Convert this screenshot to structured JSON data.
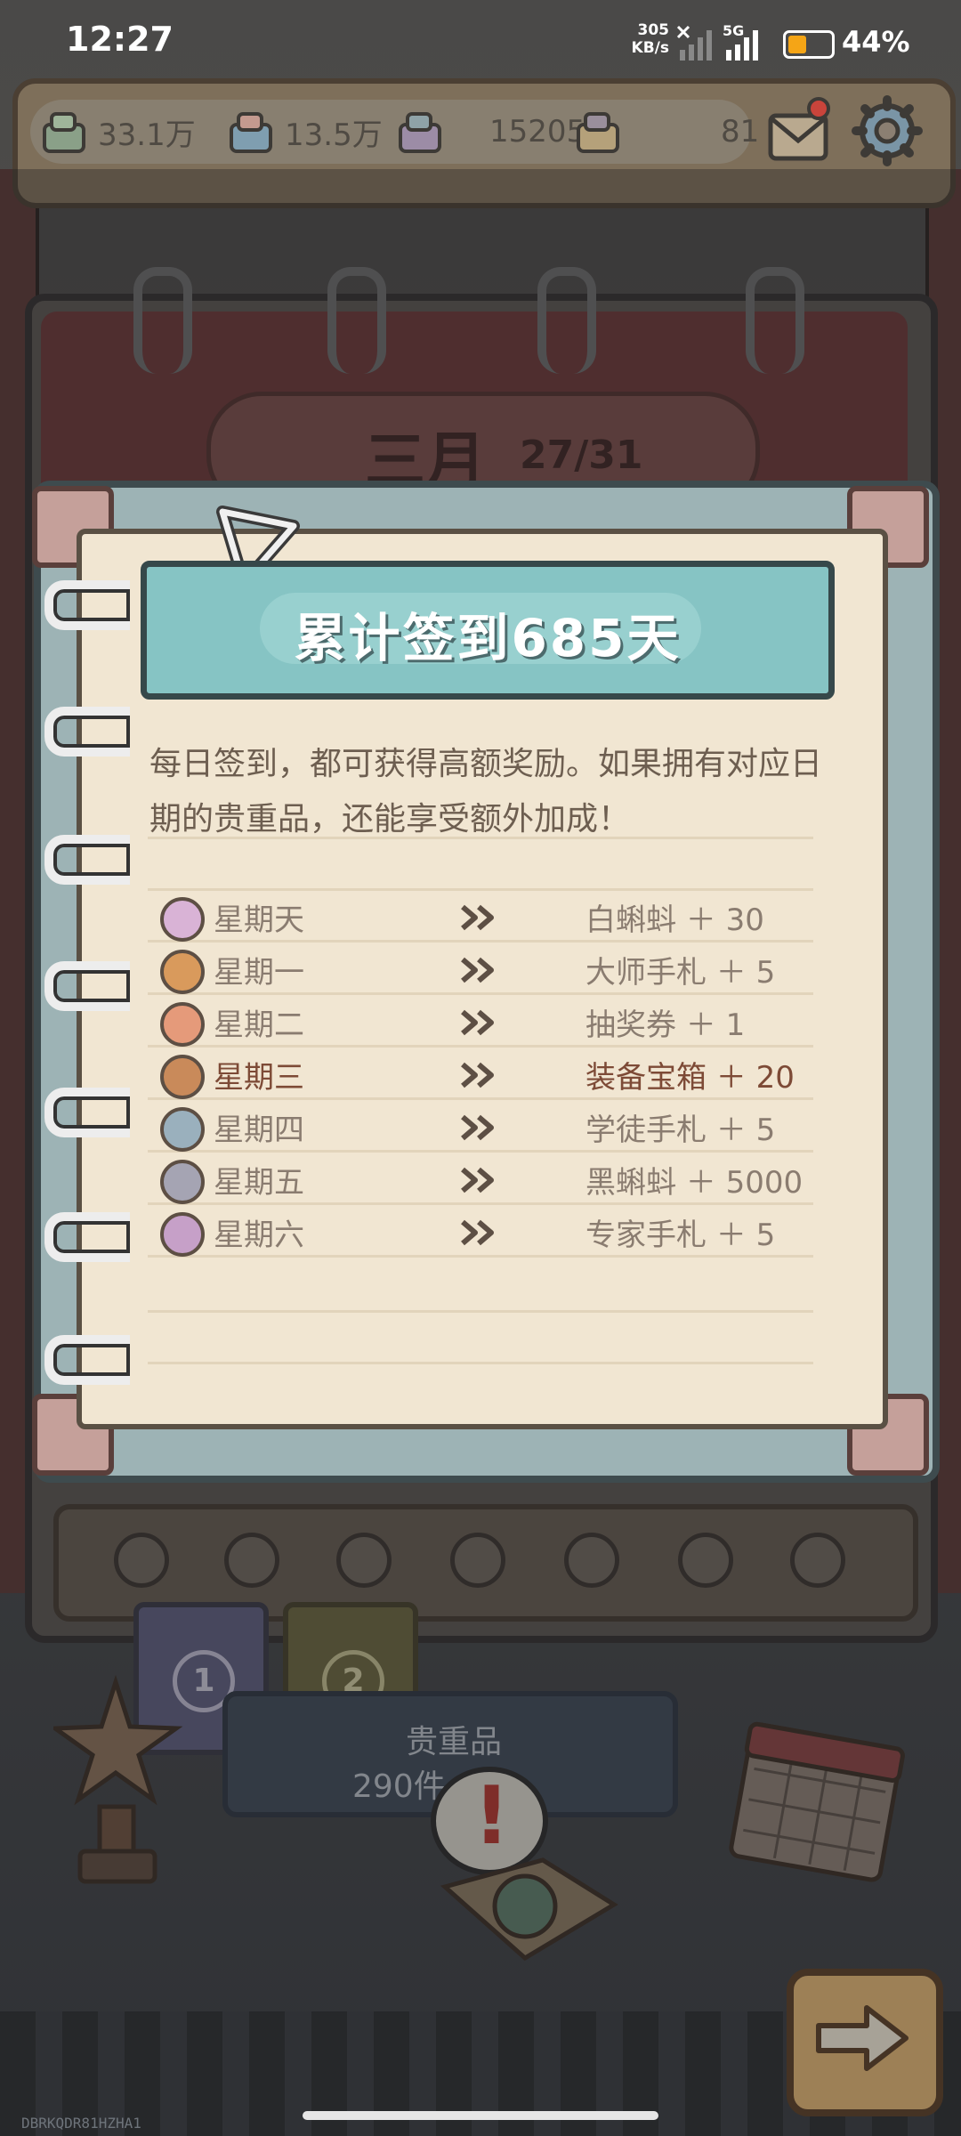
{
  "status_bar": {
    "time": "12:27",
    "net_speed": "305",
    "net_unit": "KB/s",
    "network": "5G",
    "battery": "44%",
    "battery_level": 0.44
  },
  "resources": [
    {
      "name": "gem-stack-green-icon",
      "value": "33.1万"
    },
    {
      "name": "gem-stack-blue-icon",
      "value": "13.5万"
    },
    {
      "name": "gem-stack-purple-icon",
      "value": "15205"
    },
    {
      "name": "gem-stack-gold-icon",
      "value": "81"
    }
  ],
  "calendar": {
    "month": "三月",
    "progress": "27/31"
  },
  "popup": {
    "title": "累计签到685天",
    "description": "每日签到，都可获得高额奖励。如果拥有对应日期的贵重品，还能享受额外加成！",
    "rows": [
      {
        "day": "星期天",
        "reward": "白蝌蚪 ＋ 30",
        "icon": "white-tadpole-icon",
        "color": "#d9b3d6",
        "active": false
      },
      {
        "day": "星期一",
        "reward": "大师手札 ＋ 5",
        "icon": "master-note-icon",
        "color": "#d99a5c",
        "active": false
      },
      {
        "day": "星期二",
        "reward": "抽奖券 ＋ 1",
        "icon": "lottery-ticket-icon",
        "color": "#e59a7a",
        "active": false
      },
      {
        "day": "星期三",
        "reward": "装备宝箱 ＋ 20",
        "icon": "equipment-chest-icon",
        "color": "#c98a5a",
        "active": true
      },
      {
        "day": "星期四",
        "reward": "学徒手札 ＋ 5",
        "icon": "apprentice-note-icon",
        "color": "#9ab0bd",
        "active": false
      },
      {
        "day": "星期五",
        "reward": "黑蝌蚪 ＋ 5000",
        "icon": "black-tadpole-icon",
        "color": "#a5a4b3",
        "active": false
      },
      {
        "day": "星期六",
        "reward": "专家手札 ＋ 5",
        "icon": "expert-note-icon",
        "color": "#c6a0c8",
        "active": false
      }
    ]
  },
  "valuables": {
    "label": "贵重品",
    "count": "290件"
  },
  "tabs": [
    "1",
    "2"
  ],
  "serial": "DBRKQDR81HZHA1",
  "colors": {
    "banner": "#86c4c4",
    "page": "#f1e6d2",
    "active_text": "#7d4a36",
    "muted_text": "#8a7c70"
  }
}
